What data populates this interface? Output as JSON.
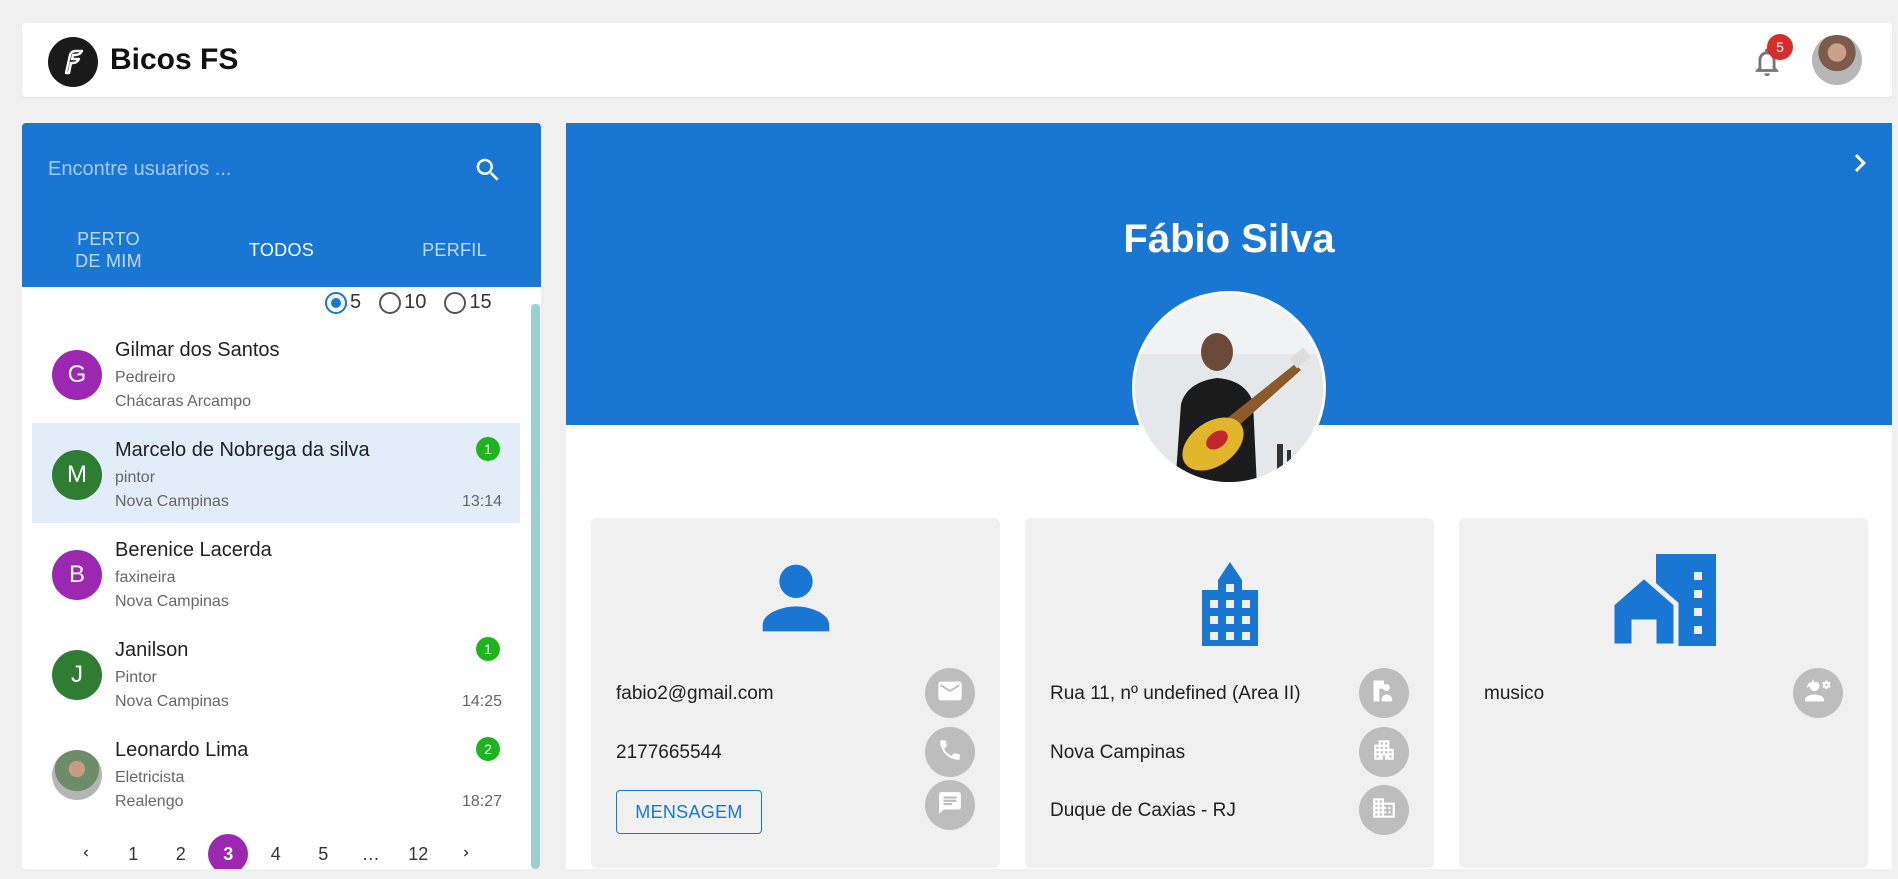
{
  "app": {
    "brand": "Bicos FS",
    "notification_count": "5"
  },
  "search": {
    "placeholder": "Encontre usuarios ..."
  },
  "tabs": [
    {
      "label": "PERTO DE MIM"
    },
    {
      "label": "TODOS"
    },
    {
      "label": "PERFIL"
    }
  ],
  "page_size": {
    "options": [
      "5",
      "10",
      "15"
    ],
    "selected": "5"
  },
  "users": [
    {
      "initial": "G",
      "name": "Gilmar dos Santos",
      "job": "Pedreiro",
      "place": "Chácaras Arcampo",
      "badge": "",
      "time": "",
      "avatar_color": "#9c27b0"
    },
    {
      "initial": "M",
      "name": "Marcelo de Nobrega da silva",
      "job": "pintor",
      "place": "Nova Campinas",
      "badge": "1",
      "time": "13:14",
      "avatar_color": "#2e7d32"
    },
    {
      "initial": "B",
      "name": "Berenice Lacerda",
      "job": "faxineira",
      "place": "Nova Campinas",
      "badge": "",
      "time": "",
      "avatar_color": "#9c27b0"
    },
    {
      "initial": "J",
      "name": "Janilson",
      "job": "Pintor",
      "place": "Nova Campinas",
      "badge": "1",
      "time": "14:25",
      "avatar_color": "#2e7d32"
    },
    {
      "initial": "",
      "name": "Leonardo Lima",
      "job": "Eletricista",
      "place": "Realengo",
      "badge": "2",
      "time": "18:27",
      "avatar_color": "#8a8a8a"
    }
  ],
  "pagination": {
    "pages": [
      "1",
      "2",
      "3",
      "4",
      "5",
      "…",
      "12"
    ],
    "current": "3"
  },
  "profile": {
    "name": "Fábio Silva",
    "email": "fabio2@gmail.com",
    "phone": "2177665544",
    "message_button": "MENSAGEM",
    "address": "Rua 11, nº undefined (Area II)",
    "neighborhood": "Nova Campinas",
    "city": "Duque de Caxias - RJ",
    "profession": "musico"
  },
  "colors": {
    "primary": "#1976d2",
    "accent": "#9c27b0",
    "badge_green": "#1fb31f",
    "badge_red": "#d32f2f"
  }
}
